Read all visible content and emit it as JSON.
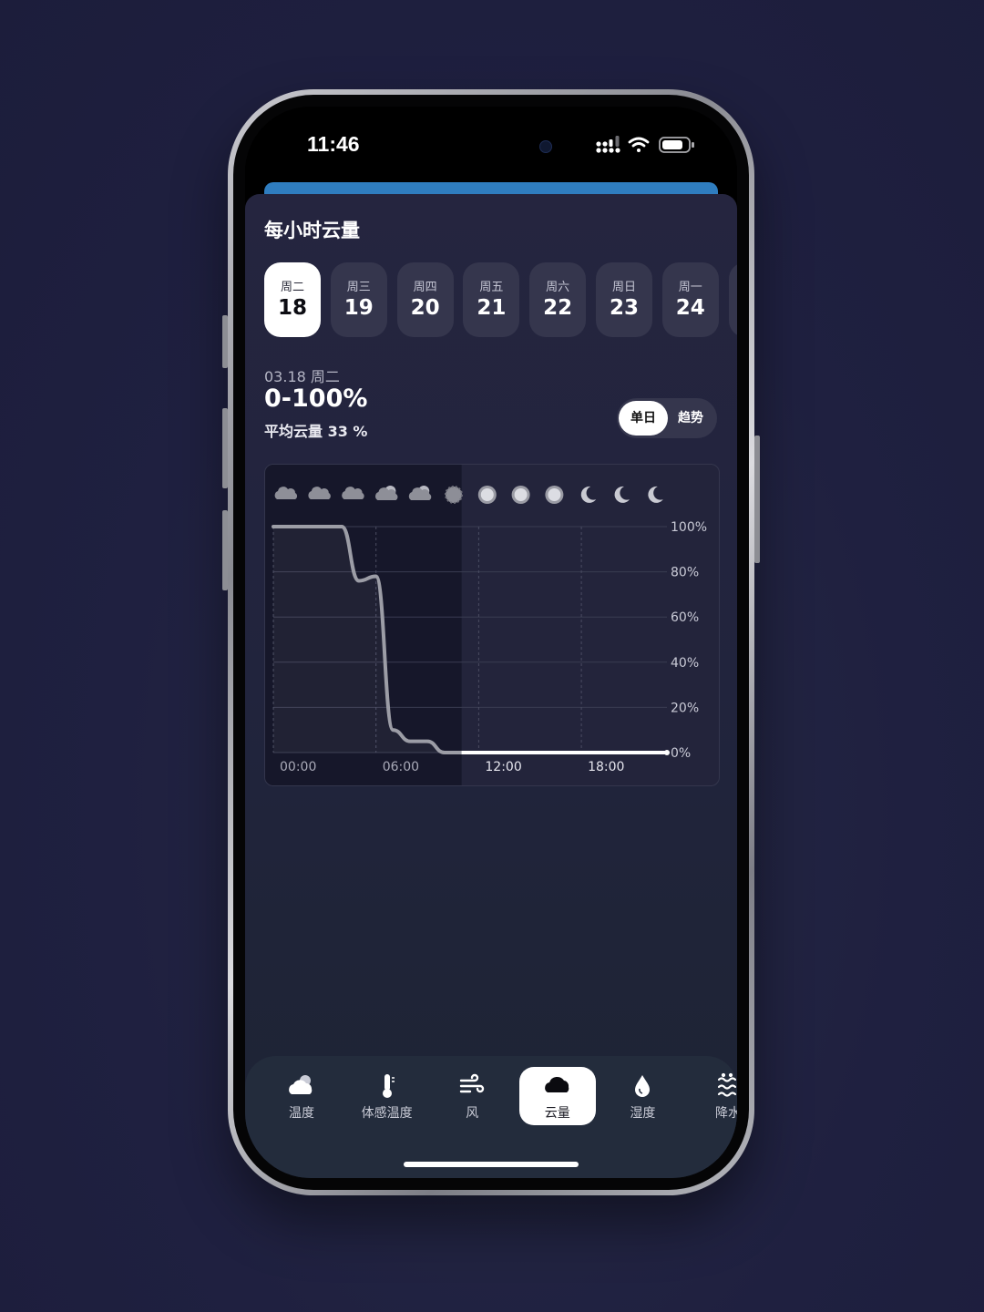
{
  "status_bar": {
    "time": "11:46",
    "icons": [
      "signal-icon",
      "wifi-icon",
      "battery-icon"
    ]
  },
  "sheet": {
    "title": "每小时云量",
    "accent_color": "#2f7dbf"
  },
  "days": [
    {
      "week": "周二",
      "num": "18",
      "active": true
    },
    {
      "week": "周三",
      "num": "19",
      "active": false
    },
    {
      "week": "周四",
      "num": "20",
      "active": false
    },
    {
      "week": "周五",
      "num": "21",
      "active": false
    },
    {
      "week": "周六",
      "num": "22",
      "active": false
    },
    {
      "week": "周日",
      "num": "23",
      "active": false
    },
    {
      "week": "周一",
      "num": "24",
      "active": false
    }
  ],
  "summary": {
    "date": "03.18 周二",
    "range": "0-100%",
    "average": "平均云量 33 %"
  },
  "segment": {
    "single": "单日",
    "trend": "趋势",
    "selected": "单日"
  },
  "chart_data": {
    "type": "line",
    "x_labels": [
      "00:00",
      "06:00",
      "12:00",
      "18:00"
    ],
    "y_labels": [
      "100%",
      "80%",
      "60%",
      "40%",
      "20%",
      "0%"
    ],
    "ylim": [
      0,
      100
    ],
    "grid": true,
    "past_shaded_until_hour": 11,
    "hourly_icons": [
      "cloud-icon",
      "cloud-icon",
      "cloud-icon",
      "partly-cloudy-icon",
      "partly-cloudy-icon",
      "hazy-sun-icon",
      "sun-icon",
      "sun-icon",
      "sun-icon",
      "moon-icon",
      "moon-icon",
      "moon-icon"
    ],
    "series": [
      {
        "x_hours": [
          0,
          1,
          2,
          3,
          4,
          5,
          6,
          7,
          8,
          9,
          10,
          11,
          12,
          13,
          14,
          15,
          16,
          17,
          18,
          19,
          20,
          21,
          22,
          23
        ],
        "values": [
          100,
          100,
          100,
          100,
          100,
          76,
          78,
          10,
          5,
          5,
          0,
          0,
          0,
          0,
          0,
          0,
          0,
          0,
          0,
          0,
          0,
          0,
          0,
          0
        ]
      }
    ]
  },
  "tabbar": {
    "items": [
      {
        "label": "温度",
        "icon": "cloud-sun-icon",
        "active": false
      },
      {
        "label": "体感温度",
        "icon": "thermometer-icon",
        "active": false
      },
      {
        "label": "风",
        "icon": "wind-icon",
        "active": false
      },
      {
        "label": "云量",
        "icon": "cloud-icon",
        "active": true
      },
      {
        "label": "湿度",
        "icon": "droplet-icon",
        "active": false
      },
      {
        "label": "降水",
        "icon": "precipitation-icon",
        "active": false
      }
    ]
  }
}
